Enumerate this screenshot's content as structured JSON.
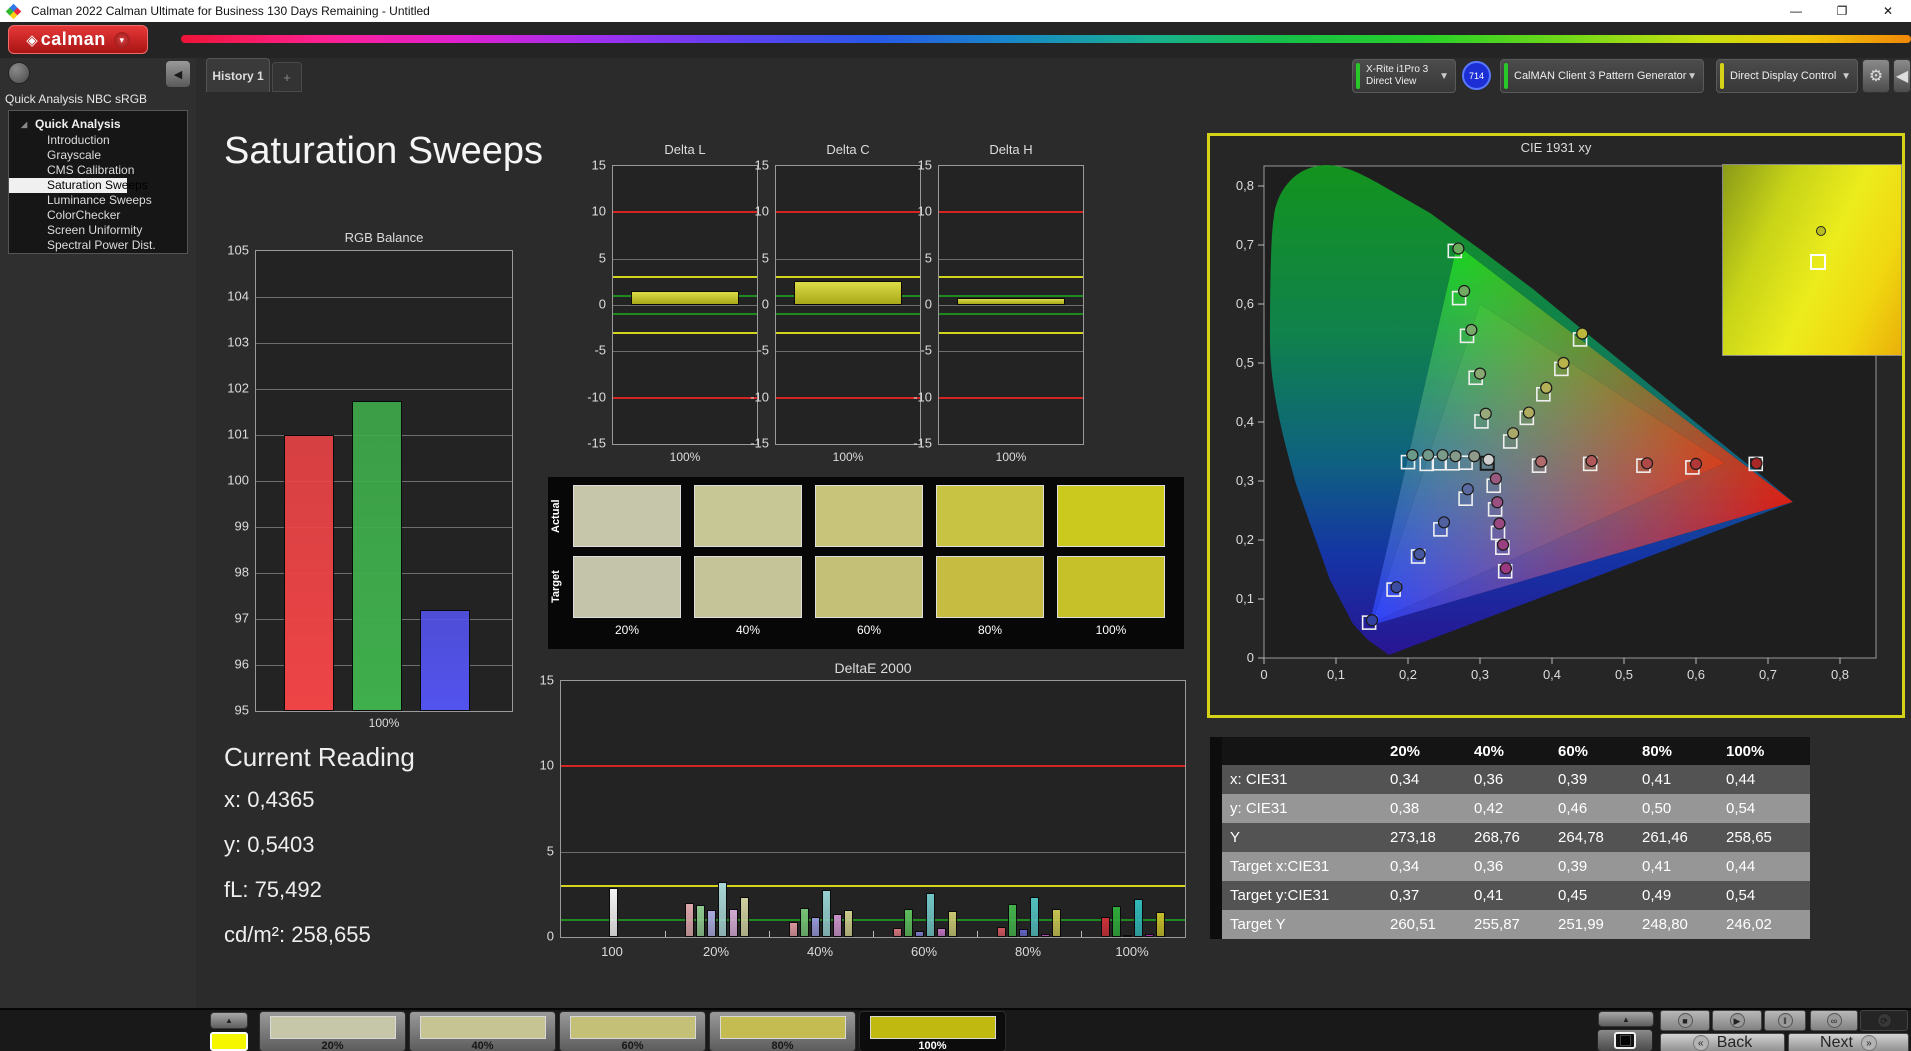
{
  "window": {
    "title": "Calman 2022 Calman Ultimate for Business 130 Days Remaining  - Untitled"
  },
  "brand": {
    "logo_text": "calman"
  },
  "tabs": {
    "history": "History 1",
    "add": "+"
  },
  "toolbar": {
    "meter": {
      "line1": "X-Rite i1Pro 3",
      "line2": "Direct View",
      "badge": "714",
      "status_color": "#28c828"
    },
    "source": {
      "label": "CalMAN Client 3 Pattern Generator",
      "status_color": "#28c828"
    },
    "display": {
      "label": "Direct Display Control",
      "status_color": "#d6d218"
    }
  },
  "sidebar": {
    "workflow_title": "Quick Analysis NBC sRGB",
    "tree_root": "Quick Analysis",
    "items": [
      "Introduction",
      "Grayscale",
      "CMS Calibration",
      "Saturation Sweeps",
      "Luminance Sweeps",
      "ColorChecker",
      "Screen Uniformity",
      "Spectral Power Dist."
    ],
    "selected_index": 3
  },
  "page": {
    "title": "Saturation Sweeps"
  },
  "current_reading": {
    "title": "Current Reading",
    "lines": [
      "x: 0,4365",
      "y: 0,5403",
      "fL: 75,492",
      "cd/m²: 258,655"
    ]
  },
  "chart_data": {
    "rgb_balance": {
      "type": "bar",
      "title": "RGB Balance",
      "categories": [
        "100%"
      ],
      "series": [
        {
          "name": "Red",
          "values": [
            101.0
          ],
          "color": "#ee4446"
        },
        {
          "name": "Green",
          "values": [
            101.75
          ],
          "color": "#3fae4c"
        },
        {
          "name": "Blue",
          "values": [
            97.2
          ],
          "color": "#5353ee"
        }
      ],
      "ylim": [
        95,
        105
      ],
      "ytick_step": 1,
      "xlabel": "100%"
    },
    "delta_charts": [
      {
        "id": "delta_l",
        "type": "bar",
        "title": "Delta L",
        "categories": [
          "100%"
        ],
        "values": [
          1.5
        ],
        "ylim": [
          -15,
          15
        ],
        "yticks": [
          15,
          10,
          5,
          0,
          -5,
          -10,
          -15
        ],
        "limits": {
          "red": 10,
          "yellow": 3,
          "green": 1
        },
        "bar_color": "#c8c832"
      },
      {
        "id": "delta_c",
        "type": "bar",
        "title": "Delta C",
        "categories": [
          "100%"
        ],
        "values": [
          2.6
        ],
        "ylim": [
          -15,
          15
        ],
        "yticks": [
          15,
          10,
          5,
          0,
          -5,
          -10,
          -15
        ],
        "limits": {
          "red": 10,
          "yellow": 3,
          "green": 1
        },
        "bar_color": "#c8c832"
      },
      {
        "id": "delta_h",
        "type": "bar",
        "title": "Delta H",
        "categories": [
          "100%"
        ],
        "values": [
          0.8
        ],
        "ylim": [
          -15,
          15
        ],
        "yticks": [
          15,
          10,
          5,
          0,
          -5,
          -10,
          -15
        ],
        "limits": {
          "red": 10,
          "yellow": 3,
          "green": 1
        },
        "bar_color": "#c8c832"
      }
    ],
    "deltae2000": {
      "type": "bar",
      "title": "DeltaE 2000",
      "ylim": [
        0,
        15
      ],
      "yticks": [
        15,
        10,
        5,
        0
      ],
      "limits": {
        "red": 10,
        "yellow": 3,
        "green": 1
      },
      "groups": [
        {
          "label": "100",
          "bars": [
            {
              "color": "#f4f4f4",
              "value": 2.9
            }
          ]
        },
        {
          "label": "20%",
          "bars": [
            {
              "color": "#dca6aa",
              "value": 2.0
            },
            {
              "color": "#8fc98f",
              "value": 1.9
            },
            {
              "color": "#a9a9dd",
              "value": 1.6
            },
            {
              "color": "#a9d6d6",
              "value": 3.2
            },
            {
              "color": "#d3a9d3",
              "value": 1.65
            },
            {
              "color": "#cfcf9f",
              "value": 2.35
            }
          ]
        },
        {
          "label": "40%",
          "bars": [
            {
              "color": "#d9959b",
              "value": 0.9
            },
            {
              "color": "#76c276",
              "value": 1.7
            },
            {
              "color": "#9595d5",
              "value": 1.2
            },
            {
              "color": "#95cfcf",
              "value": 2.75
            },
            {
              "color": "#c791c7",
              "value": 1.35
            },
            {
              "color": "#cbcb8b",
              "value": 1.6
            }
          ]
        },
        {
          "label": "60%",
          "bars": [
            {
              "color": "#d4747c",
              "value": 0.55
            },
            {
              "color": "#5cba5c",
              "value": 1.65
            },
            {
              "color": "#7d7dcd",
              "value": 0.35
            },
            {
              "color": "#72c6c6",
              "value": 2.6
            },
            {
              "color": "#c273c2",
              "value": 0.5
            },
            {
              "color": "#c6c672",
              "value": 1.55
            }
          ]
        },
        {
          "label": "80%",
          "bars": [
            {
              "color": "#d0565e",
              "value": 0.6
            },
            {
              "color": "#44b24c",
              "value": 1.95
            },
            {
              "color": "#6464c8",
              "value": 0.45
            },
            {
              "color": "#52c0c0",
              "value": 2.35
            },
            {
              "color": "#bd54bd",
              "value": 0.15
            },
            {
              "color": "#c6c352",
              "value": 1.65
            }
          ]
        },
        {
          "label": "100%",
          "bars": [
            {
              "color": "#cc3038",
              "value": 1.15
            },
            {
              "color": "#2faa3a",
              "value": 1.8
            },
            {
              "color": "#4848c4",
              "value": 0.05
            },
            {
              "color": "#30b8b8",
              "value": 2.2
            },
            {
              "color": "#b832b8",
              "value": 0.15
            },
            {
              "color": "#c4bd2a",
              "value": 1.45
            }
          ]
        }
      ]
    },
    "cie": {
      "type": "scatter",
      "title": "CIE 1931 xy",
      "xlim": [
        0,
        0.84
      ],
      "ylim": [
        0,
        0.84
      ],
      "xticks": [
        "0",
        "0,1",
        "0,2",
        "0,3",
        "0,4",
        "0,5",
        "0,6",
        "0,7",
        "0,8"
      ],
      "yticks": [
        "0",
        "0,1",
        "0,2",
        "0,3",
        "0,4",
        "0,5",
        "0,6",
        "0,7",
        "0,8"
      ],
      "targets": [
        {
          "x": 0.31,
          "y": 0.33,
          "wp": true
        },
        {
          "x": 0.382,
          "y": 0.326
        },
        {
          "x": 0.453,
          "y": 0.329
        },
        {
          "x": 0.527,
          "y": 0.326
        },
        {
          "x": 0.595,
          "y": 0.323
        },
        {
          "x": 0.683,
          "y": 0.329
        },
        {
          "x": 0.265,
          "y": 0.69
        },
        {
          "x": 0.271,
          "y": 0.61
        },
        {
          "x": 0.282,
          "y": 0.546
        },
        {
          "x": 0.294,
          "y": 0.475
        },
        {
          "x": 0.302,
          "y": 0.401
        },
        {
          "x": 0.342,
          "y": 0.367
        },
        {
          "x": 0.365,
          "y": 0.407
        },
        {
          "x": 0.388,
          "y": 0.447
        },
        {
          "x": 0.413,
          "y": 0.49
        },
        {
          "x": 0.439,
          "y": 0.54
        },
        {
          "x": 0.2,
          "y": 0.332
        },
        {
          "x": 0.226,
          "y": 0.329
        },
        {
          "x": 0.243,
          "y": 0.33
        },
        {
          "x": 0.262,
          "y": 0.33
        },
        {
          "x": 0.28,
          "y": 0.331
        },
        {
          "x": 0.28,
          "y": 0.27
        },
        {
          "x": 0.245,
          "y": 0.218
        },
        {
          "x": 0.214,
          "y": 0.172
        },
        {
          "x": 0.18,
          "y": 0.116
        },
        {
          "x": 0.146,
          "y": 0.06
        },
        {
          "x": 0.319,
          "y": 0.292
        },
        {
          "x": 0.321,
          "y": 0.252
        },
        {
          "x": 0.325,
          "y": 0.212
        },
        {
          "x": 0.331,
          "y": 0.187
        },
        {
          "x": 0.335,
          "y": 0.147
        }
      ],
      "measured": [
        {
          "x": 0.312,
          "y": 0.336,
          "c": "#cfcfcf"
        },
        {
          "x": 0.385,
          "y": 0.333,
          "c": "#b06a6a"
        },
        {
          "x": 0.455,
          "y": 0.334,
          "c": "#b05858"
        },
        {
          "x": 0.532,
          "y": 0.33,
          "c": "#b04848"
        },
        {
          "x": 0.6,
          "y": 0.329,
          "c": "#b03838"
        },
        {
          "x": 0.684,
          "y": 0.33,
          "c": "#a82828"
        },
        {
          "x": 0.27,
          "y": 0.694,
          "c": "#6aaa5a"
        },
        {
          "x": 0.278,
          "y": 0.622,
          "c": "#72aa62"
        },
        {
          "x": 0.288,
          "y": 0.556,
          "c": "#7aaa6a"
        },
        {
          "x": 0.3,
          "y": 0.482,
          "c": "#88aa72"
        },
        {
          "x": 0.308,
          "y": 0.414,
          "c": "#96aa7a"
        },
        {
          "x": 0.346,
          "y": 0.381,
          "c": "#a8a868"
        },
        {
          "x": 0.368,
          "y": 0.416,
          "c": "#b0ac60"
        },
        {
          "x": 0.392,
          "y": 0.458,
          "c": "#b4b058"
        },
        {
          "x": 0.416,
          "y": 0.5,
          "c": "#b8b44a"
        },
        {
          "x": 0.442,
          "y": 0.55,
          "c": "#bcb83c"
        },
        {
          "x": 0.206,
          "y": 0.344,
          "c": "#6a9a8a"
        },
        {
          "x": 0.228,
          "y": 0.344,
          "c": "#729a8a"
        },
        {
          "x": 0.248,
          "y": 0.344,
          "c": "#7a9a8a"
        },
        {
          "x": 0.266,
          "y": 0.342,
          "c": "#849a8a"
        },
        {
          "x": 0.292,
          "y": 0.342,
          "c": "#8e9a8a"
        },
        {
          "x": 0.283,
          "y": 0.286,
          "c": "#5a6aa0"
        },
        {
          "x": 0.25,
          "y": 0.23,
          "c": "#5060a0"
        },
        {
          "x": 0.216,
          "y": 0.176,
          "c": "#4656a0"
        },
        {
          "x": 0.184,
          "y": 0.12,
          "c": "#3c4ca0"
        },
        {
          "x": 0.15,
          "y": 0.064,
          "c": "#3242a0"
        },
        {
          "x": 0.322,
          "y": 0.304,
          "c": "#9a5a80"
        },
        {
          "x": 0.324,
          "y": 0.264,
          "c": "#9a5080"
        },
        {
          "x": 0.327,
          "y": 0.228,
          "c": "#9a4880"
        },
        {
          "x": 0.332,
          "y": 0.192,
          "c": "#9a4080"
        },
        {
          "x": 0.336,
          "y": 0.152,
          "c": "#9a3880"
        }
      ]
    },
    "table": {
      "columns": [
        "20%",
        "40%",
        "60%",
        "80%",
        "100%"
      ],
      "rows": [
        {
          "label": "x: CIE31",
          "values": [
            "0,34",
            "0,36",
            "0,39",
            "0,41",
            "0,44"
          ]
        },
        {
          "label": "y: CIE31",
          "values": [
            "0,38",
            "0,42",
            "0,46",
            "0,50",
            "0,54"
          ]
        },
        {
          "label": "Y",
          "values": [
            "273,18",
            "268,76",
            "264,78",
            "261,46",
            "258,65"
          ]
        },
        {
          "label": "Target x:CIE31",
          "values": [
            "0,34",
            "0,36",
            "0,39",
            "0,41",
            "0,44"
          ]
        },
        {
          "label": "Target y:CIE31",
          "values": [
            "0,37",
            "0,41",
            "0,45",
            "0,49",
            "0,54"
          ]
        },
        {
          "label": "Target Y",
          "values": [
            "260,51",
            "255,87",
            "251,99",
            "248,80",
            "246,02"
          ]
        }
      ]
    }
  },
  "swatches": {
    "row_labels": [
      "Actual",
      "Target"
    ],
    "labels": [
      "20%",
      "40%",
      "60%",
      "80%",
      "100%"
    ],
    "actual": [
      "#c6c6ab",
      "#c7c795",
      "#c8c57a",
      "#c9c344",
      "#cbc81e"
    ],
    "target": [
      "#c4c4aa",
      "#c5c498",
      "#c5c078",
      "#c6bc42",
      "#c6c128"
    ]
  },
  "bottom": {
    "current_color": "#f6f600",
    "patterns": [
      {
        "label": "20%",
        "color": "#c6c6a9"
      },
      {
        "label": "40%",
        "color": "#c6c492"
      },
      {
        "label": "60%",
        "color": "#c4c077"
      },
      {
        "label": "80%",
        "color": "#c4bc50"
      },
      {
        "label": "100%",
        "color": "#c0ba10"
      }
    ],
    "selected_index": 4,
    "transport": {
      "back": "Back",
      "next": "Next"
    }
  }
}
